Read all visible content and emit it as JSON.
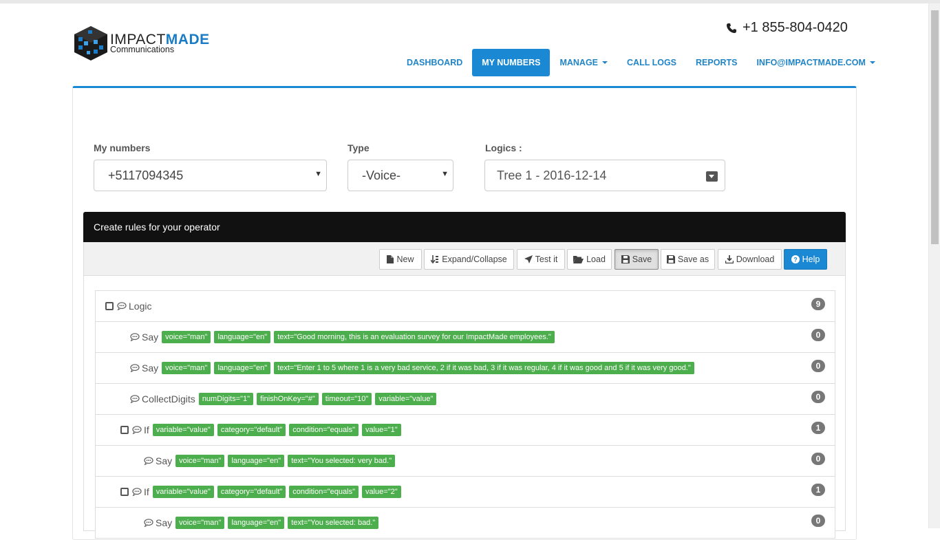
{
  "brand": {
    "name_part1": "IMPACT",
    "name_part2": "MADE",
    "subtitle": "Communications",
    "phone": "+1 855-804-0420"
  },
  "nav": [
    {
      "label": "DASHBOARD",
      "active": false,
      "dropdown": false
    },
    {
      "label": "MY NUMBERS",
      "active": true,
      "dropdown": false
    },
    {
      "label": "MANAGE",
      "active": false,
      "dropdown": true
    },
    {
      "label": "CALL LOGS",
      "active": false,
      "dropdown": false
    },
    {
      "label": "REPORTS",
      "active": false,
      "dropdown": false
    },
    {
      "label": "INFO@IMPACTMADE.COM",
      "active": false,
      "dropdown": true
    }
  ],
  "filters": {
    "numbers_label": "My numbers",
    "numbers_value": "+5117094345",
    "type_label": "Type",
    "type_value": "-Voice-",
    "logics_label": "Logics :",
    "logics_value": "Tree 1 - 2016-12-14"
  },
  "rules": {
    "header": "Create rules for your operator",
    "toolbar": {
      "new": "New",
      "expand": "Expand/Collapse",
      "test": "Test it",
      "load": "Load",
      "save": "Save",
      "save_as": "Save as",
      "download": "Download",
      "help": "Help"
    },
    "tree": [
      {
        "name": "Logic",
        "checkbox": true,
        "tags": [],
        "count": "9"
      },
      {
        "name": "Say",
        "checkbox": false,
        "tags": [
          "voice=\"man\"",
          "language=\"en\"",
          "text=\"Good morning, this is an evaluation survey for our ImpactMade employees.\""
        ],
        "count": "0"
      },
      {
        "name": "Say",
        "checkbox": false,
        "tags": [
          "voice=\"man\"",
          "language=\"en\"",
          "text=\"Enter 1 to 5 where 1 is a very bad service, 2 if it was bad, 3 if it was regular, 4 if it was good and 5 if it was very good.\""
        ],
        "count": "0"
      },
      {
        "name": "CollectDigits",
        "checkbox": false,
        "tags": [
          "numDigits=\"1\"",
          "finishOnKey=\"#\"",
          "timeout=\"10\"",
          "variable=\"value\""
        ],
        "count": "0"
      },
      {
        "name": "If",
        "checkbox": true,
        "tags": [
          "variable=\"value\"",
          "category=\"default\"",
          "condition=\"equals\"",
          "value=\"1\""
        ],
        "count": "1"
      },
      {
        "name": "Say",
        "checkbox": false,
        "tags": [
          "voice=\"man\"",
          "language=\"en\"",
          "text=\"You selected: very bad.\""
        ],
        "count": "0"
      },
      {
        "name": "If",
        "checkbox": true,
        "tags": [
          "variable=\"value\"",
          "category=\"default\"",
          "condition=\"equals\"",
          "value=\"2\""
        ],
        "count": "1"
      },
      {
        "name": "Say",
        "checkbox": false,
        "tags": [
          "voice=\"man\"",
          "language=\"en\"",
          "text=\"You selected: bad.\""
        ],
        "count": "0"
      }
    ]
  },
  "colors": {
    "accent": "#1a88d2",
    "tag": "#4cae4c",
    "badge": "#777777",
    "header": "#111111"
  }
}
